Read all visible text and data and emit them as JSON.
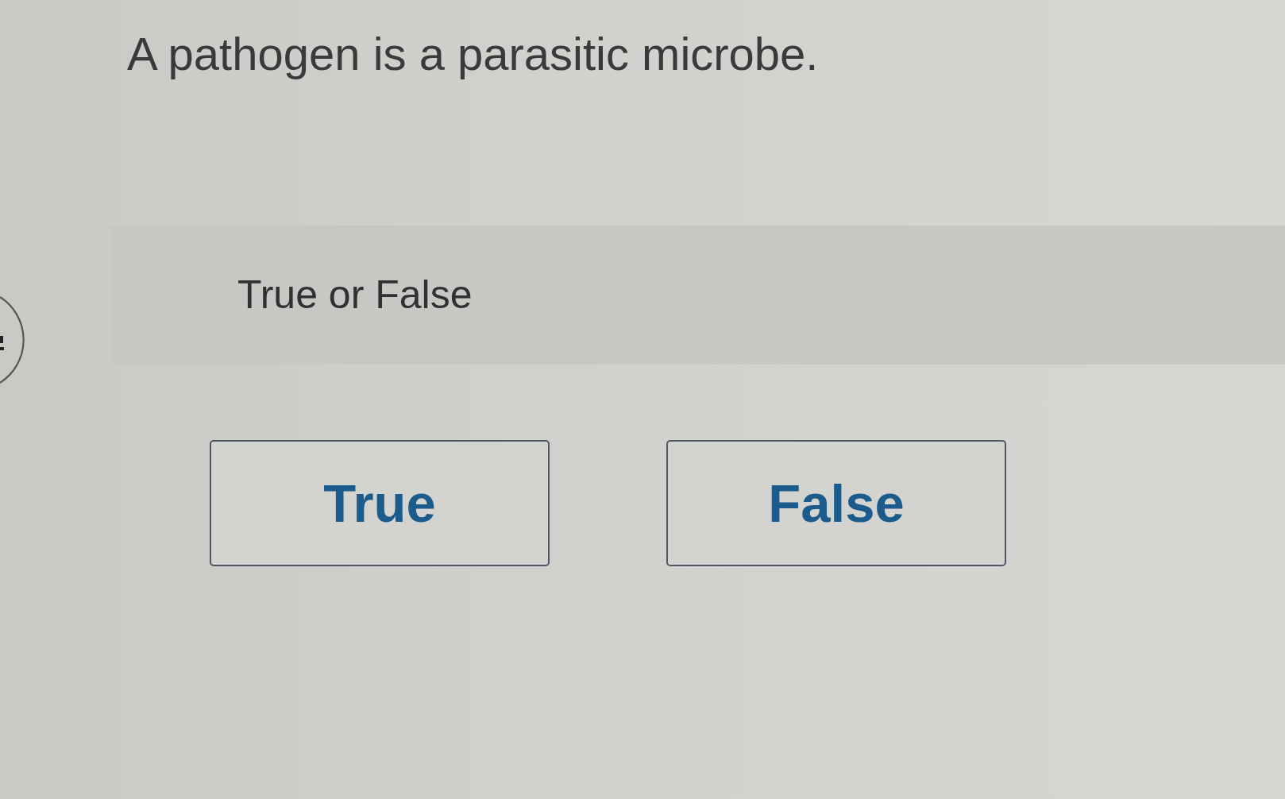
{
  "question": {
    "text": "A pathogen is a parasitic microbe."
  },
  "prompt": {
    "label": "True or False"
  },
  "options": [
    {
      "label": "True",
      "selected": false
    },
    {
      "label": "False",
      "selected": false
    }
  ]
}
